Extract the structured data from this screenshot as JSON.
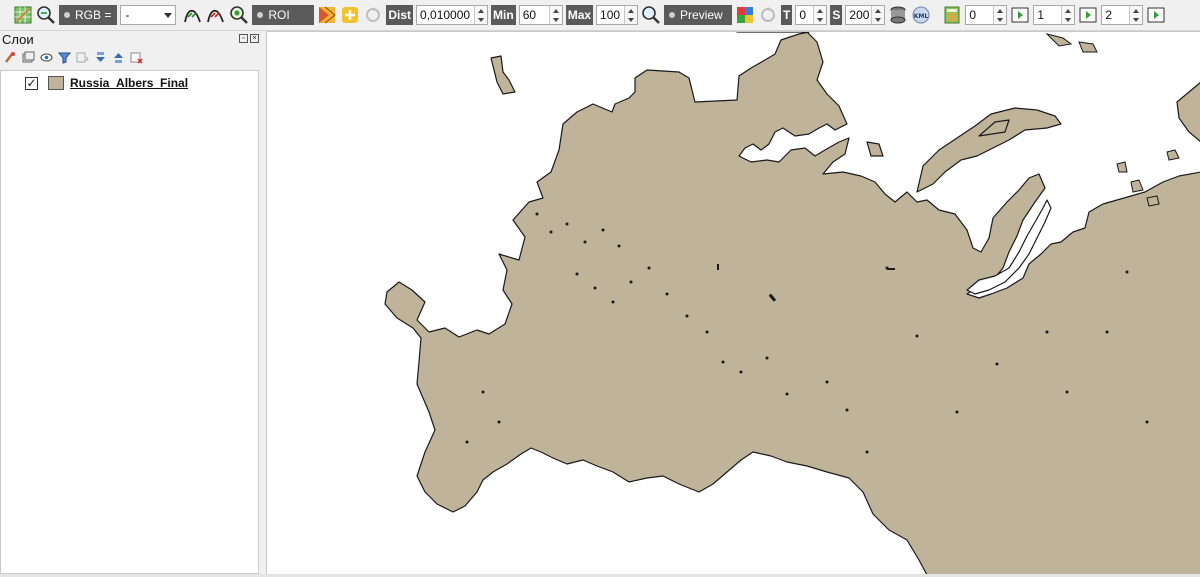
{
  "toolbar": {
    "icons": [
      "layer-grid-icon",
      "zoom-search-icon",
      "zoom-icon",
      "curve-icon",
      "curve-red-icon",
      "zoom-green-icon",
      "roi-color-icon",
      "add-roi-icon",
      "refresh-icon",
      "zoom-preview-icon",
      "color-squares-icon",
      "refresh-gray-icon",
      "stack-icon",
      "kml-icon",
      "calc-icon"
    ],
    "rgb_button": "RGB =",
    "rgb_select_value": "-",
    "roi_button": "ROI",
    "dist_label": "Dist",
    "dist_value": "0,010000",
    "min_label": "Min",
    "min_value": "60",
    "max_label": "Max",
    "max_value": "100",
    "preview_button": "Preview",
    "t_label": "T",
    "t_value": "0",
    "s_label": "S",
    "s_value": "200",
    "kml_text": "KML",
    "band_values": [
      "0",
      "1",
      "2"
    ]
  },
  "layers_panel": {
    "title": "Слои",
    "layers": [
      {
        "name": "Russia_Albers_Final",
        "checked": true,
        "check_mark": "✓"
      }
    ]
  },
  "colors": {
    "land_fill": "#bfb39a",
    "coastline": "#1a1a1a",
    "accent_green": "#3a9a3a",
    "dark_button": "#5a5a5a"
  }
}
